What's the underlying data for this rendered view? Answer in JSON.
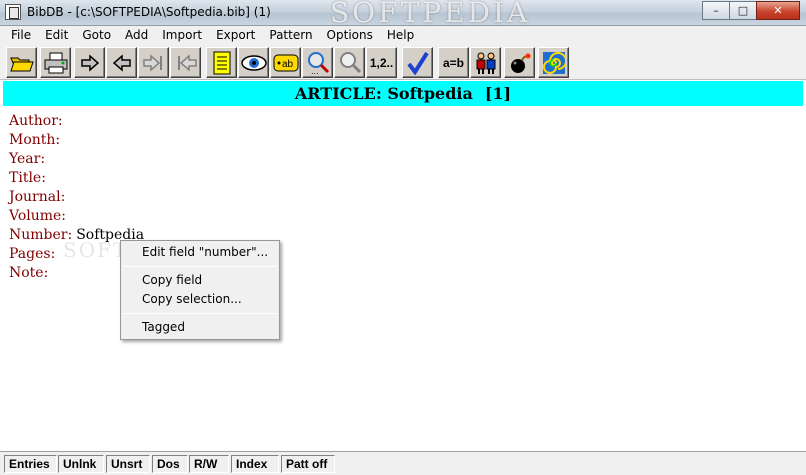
{
  "window": {
    "title": "BibDB - [c:\\SOFTPEDIA\\Softpedia.bib] (1)",
    "watermark": "SOFTPEDIA",
    "buttons": {
      "minimize": "–",
      "maximize": "□",
      "close": "✕"
    }
  },
  "menu": [
    "File",
    "Edit",
    "Goto",
    "Add",
    "Import",
    "Export",
    "Pattern",
    "Options",
    "Help"
  ],
  "toolbar": {
    "numbering_label": "1,2..",
    "compare_label": "a=b",
    "icons": [
      "open-folder-icon",
      "print-icon",
      "next-arrow-icon",
      "prev-arrow-icon",
      "last-record-icon",
      "first-record-icon",
      "notepad-icon",
      "view-eye-icon",
      "edit-field-icon",
      "find-next-icon",
      "search-icon",
      "numbering-icon",
      "checkmark-icon",
      "compare-icon",
      "people-icon",
      "bomb-icon",
      "spiral-icon"
    ]
  },
  "record": {
    "type_label": "ARTICLE: Softpedia",
    "index": "[1]",
    "fields": [
      {
        "label": "Author:",
        "value": ""
      },
      {
        "label": "Month:",
        "value": ""
      },
      {
        "label": "Year:",
        "value": ""
      },
      {
        "label": "Title:",
        "value": ""
      },
      {
        "label": "Journal:",
        "value": ""
      },
      {
        "label": "Volume:",
        "value": ""
      },
      {
        "label": "Number:",
        "value": "Softpedia"
      },
      {
        "label": "Pages:",
        "value": ""
      },
      {
        "label": "Note:",
        "value": ""
      }
    ]
  },
  "context_menu": {
    "items": [
      "Edit field \"number\"...",
      "Copy field",
      "Copy selection...",
      "Tagged"
    ]
  },
  "status": [
    "Entries",
    "Unlnk",
    "Unsrt",
    "Dos",
    "R/W",
    "Index",
    "Patt off"
  ],
  "colors": {
    "header_bg": "#00ffff",
    "field_label": "#800000"
  }
}
